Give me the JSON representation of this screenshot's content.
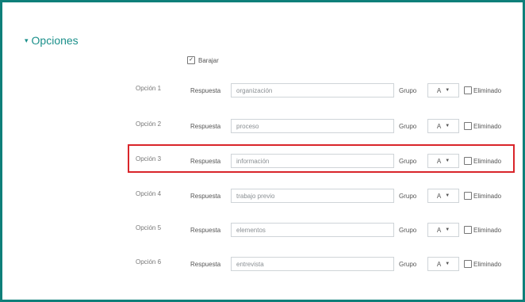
{
  "section": {
    "caret": "▾",
    "title": "Opciones"
  },
  "shuffle": {
    "checked_mark": "✓",
    "label": "Barajar"
  },
  "labels": {
    "respuesta": "Respuesta",
    "grupo": "Grupo",
    "eliminado": "Eliminado"
  },
  "options": [
    {
      "label": "Opción 1",
      "value": "organización",
      "group": "A"
    },
    {
      "label": "Opción 2",
      "value": "proceso",
      "group": "A"
    },
    {
      "label": "Opción 3",
      "value": "información",
      "group": "A"
    },
    {
      "label": "Opción 4",
      "value": "trabajo previo",
      "group": "A"
    },
    {
      "label": "Opción 5",
      "value": "elementos",
      "group": "A"
    },
    {
      "label": "Opción 6",
      "value": "entrevista",
      "group": "A"
    }
  ],
  "highlighted_option_index": 2,
  "colors": {
    "frame": "#0f7f7a",
    "accent": "#1a8f8a",
    "highlight": "#d9252a"
  }
}
